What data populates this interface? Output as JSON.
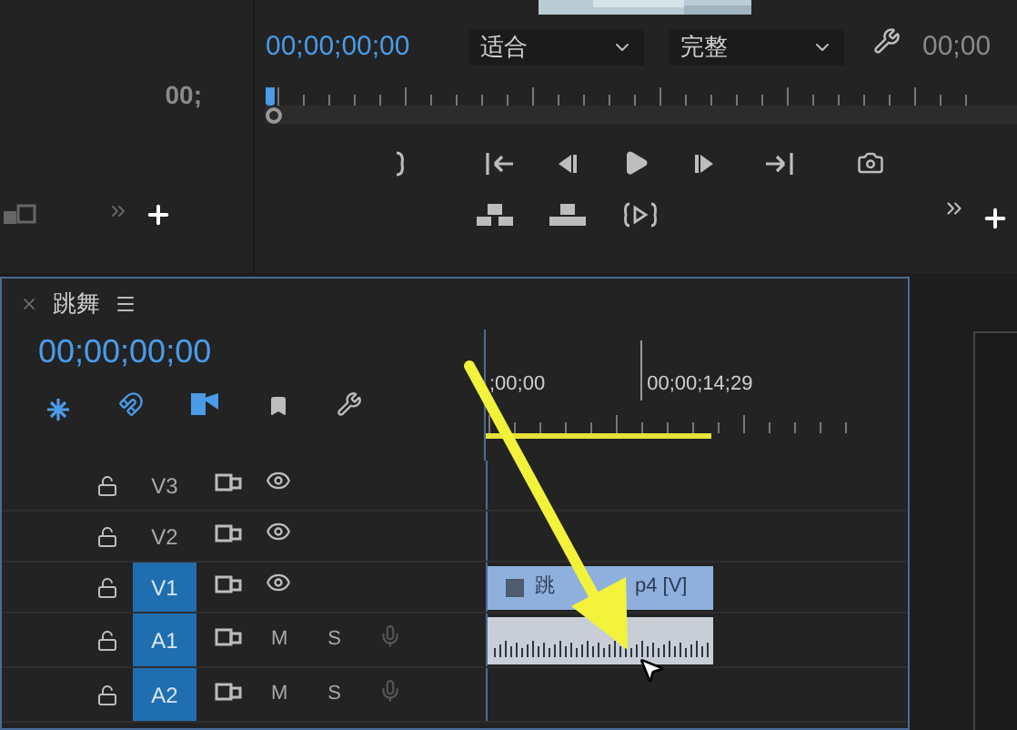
{
  "source_panel": {
    "timecode": "00;"
  },
  "program_monitor": {
    "timecode": "00;00;00;00",
    "zoom_select": "适合",
    "quality_select": "完整",
    "timecode_right": "00;00"
  },
  "timeline": {
    "sequence_tab": "跳舞",
    "timecode": "00;00;00;00",
    "ruler_labels": [
      ";00;00",
      "00;00;14;29"
    ],
    "tracks": [
      {
        "kind": "video",
        "name": "V3",
        "targeted": false
      },
      {
        "kind": "video",
        "name": "V2",
        "targeted": false
      },
      {
        "kind": "video",
        "name": "V1",
        "targeted": true,
        "clip": {
          "kind": "video",
          "label_start": "跳",
          "label_end": "p4 [V]"
        }
      },
      {
        "kind": "audio",
        "name": "A1",
        "targeted": true,
        "mute": "M",
        "solo": "S",
        "clip": {
          "kind": "audio"
        }
      },
      {
        "kind": "audio",
        "name": "A2",
        "targeted": true,
        "mute": "M",
        "solo": "S"
      }
    ]
  }
}
